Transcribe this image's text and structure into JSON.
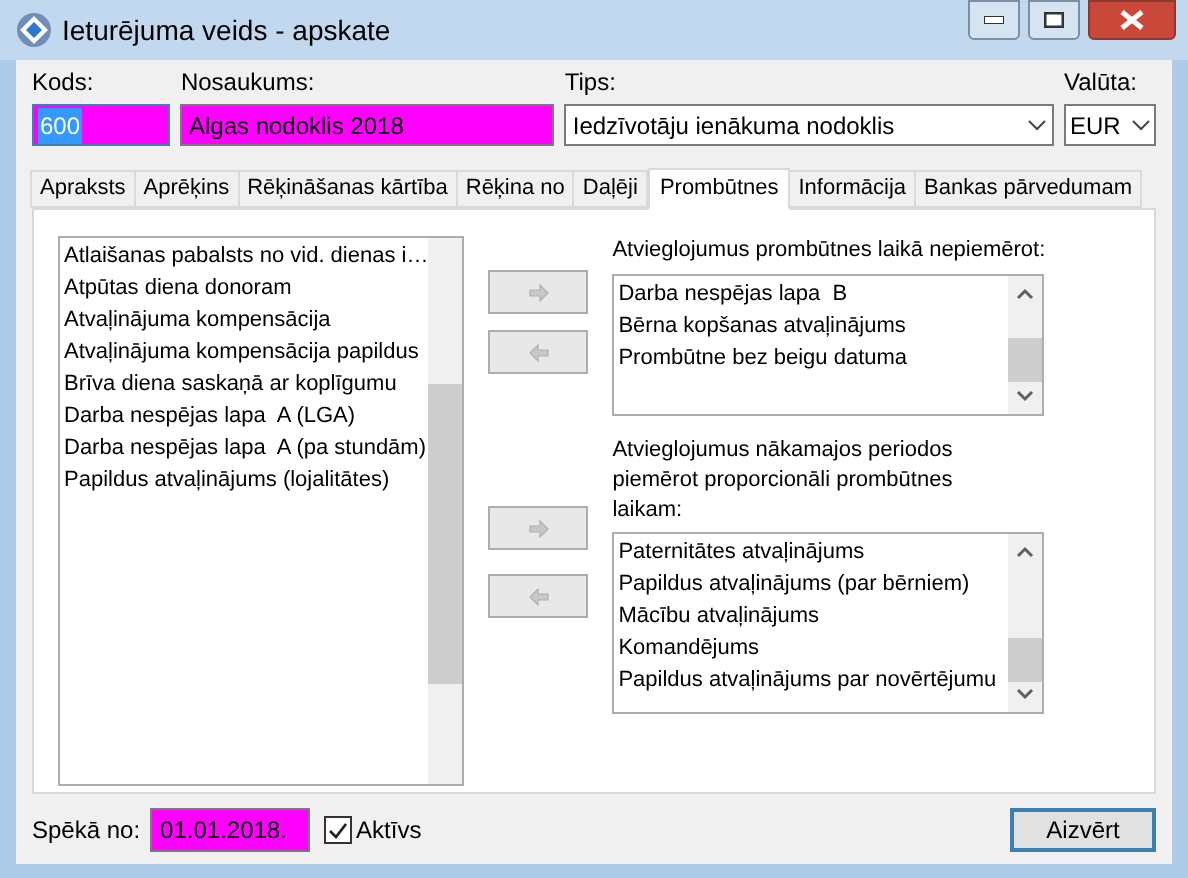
{
  "window": {
    "title": "Ieturējuma veids - apskate"
  },
  "fields": {
    "code": {
      "label": "Kods:",
      "value": "600"
    },
    "name": {
      "label": "Nosaukums:",
      "value": "Algas nodoklis 2018"
    },
    "type": {
      "label": "Tips:",
      "value": "Iedzīvotāju ienākuma nodoklis"
    },
    "currency": {
      "label": "Valūta:",
      "value": "EUR"
    }
  },
  "tabs": [
    {
      "label": "Apraksts",
      "selected": false
    },
    {
      "label": "Aprēķins",
      "selected": false
    },
    {
      "label": "Rēķināšanas kārtība",
      "selected": false
    },
    {
      "label": "Rēķina no",
      "selected": false
    },
    {
      "label": "Daļēji",
      "selected": false
    },
    {
      "label": "Prombūtnes",
      "selected": true
    },
    {
      "label": "Informācija",
      "selected": false
    },
    {
      "label": "Bankas pārvedumam",
      "selected": false
    }
  ],
  "available": [
    "Atlaišanas pabalsts no vid. dienas i…",
    "Atpūtas diena donoram",
    "Atvaļinājuma kompensācija",
    "Atvaļinājuma kompensācija papildus",
    "Brīva diena saskaņā ar koplīgumu",
    "Darba nespējas lapa  A (LGA)",
    "Darba nespējas lapa  A (pa stundām)",
    "Papildus atvaļinājums (lojalitātes)"
  ],
  "not_applied": {
    "label": "Atvieglojumus prombūtnes laikā nepiemērot:",
    "items": [
      "Darba nespējas lapa  B",
      "Bērna kopšanas atvaļinājums",
      "Prombūtne bez beigu datuma"
    ]
  },
  "proportional": {
    "label": "Atvieglojumus nākamajos periodos piemērot proporcionāli prombūtnes laikam:",
    "items": [
      "Paternitātes atvaļinājums",
      "Papildus atvaļinājums (par bērniem)",
      "Mācību atvaļinājums",
      "Komandējums",
      "Papildus atvaļinājums par novērtējumu"
    ]
  },
  "valid_from": {
    "label": "Spēkā no:",
    "value": "01.01.2018."
  },
  "active": {
    "label": "Aktīvs",
    "checked": true
  },
  "close_button": "Aizvērt"
}
